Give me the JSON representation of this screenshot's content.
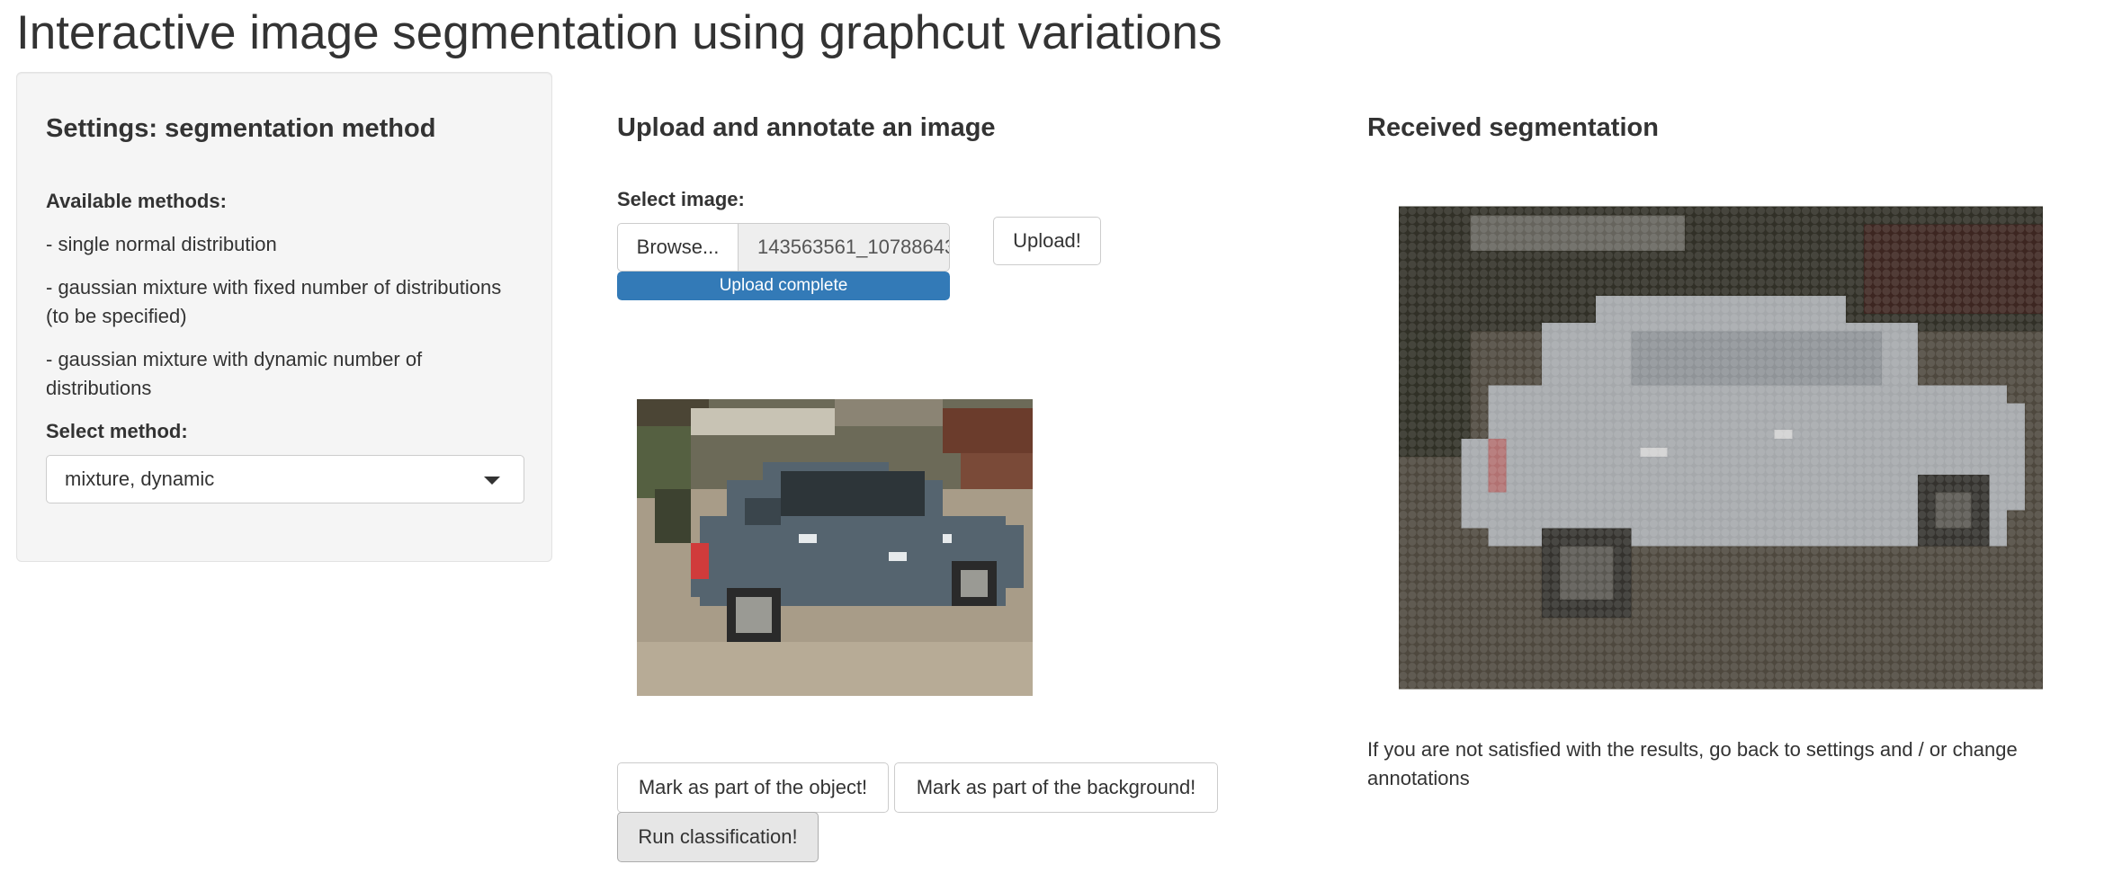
{
  "page": {
    "title": "Interactive image segmentation using graphcut variations"
  },
  "sidebar": {
    "heading": "Settings: segmentation method",
    "methods_label": "Available methods:",
    "methods": [
      "- single normal distribution",
      "- gaussian mixture with fixed number of distributions (to be specified)",
      "- gaussian mixture with dynamic number of distributions"
    ],
    "select_label": "Select method:",
    "select_value": "mixture, dynamic"
  },
  "upload_panel": {
    "heading": "Upload and annotate an image",
    "select_image_label": "Select image:",
    "browse_label": "Browse...",
    "file_name": "143563561_10788643",
    "progress_text": "Upload complete",
    "progress_fraction": 1.0,
    "upload_button_label": "Upload!",
    "mark_object_label": "Mark as part of the object!",
    "mark_background_label": "Mark as part of the background!",
    "run_label": "Run classification!"
  },
  "result_panel": {
    "heading": "Received segmentation",
    "note": "If you are not satisfied with the results, go back to settings and / or change annotations"
  },
  "colors": {
    "accent": "#337ab7",
    "car_body": "#55646f",
    "background_gravel": "#a89c88",
    "segmentation_car": "#c9cdd1"
  }
}
